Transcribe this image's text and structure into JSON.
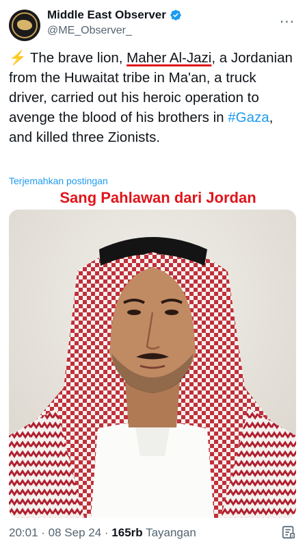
{
  "account": {
    "name": "Middle East Observer",
    "handle": "@ME_Observer_",
    "more_label": "···"
  },
  "tweet": {
    "bolt": "⚡",
    "part1": " The brave lion, ",
    "name_link": "Maher Al-Jazi",
    "part2": ", a Jordanian from the Huwaitat tribe in Ma'an, a truck driver, carried out his heroic operation to avenge the blood of his brothers in ",
    "hashtag": "#Gaza",
    "part3": ", and killed three Zionists."
  },
  "translate_label": "Terjemahkan postingan",
  "overlay_caption": "Sang Pahlawan dari Jordan",
  "footer": {
    "time": "20:01",
    "sep1": " · ",
    "date": "08 Sep 24",
    "sep2": " · ",
    "views_count": "165rb",
    "views_label": " Tayangan"
  },
  "colors": {
    "accent_blue": "#1d9bf0",
    "caption_red": "#e0141a",
    "underline_red": "#e0141a",
    "verified_blue": "#1d9bf0"
  },
  "icons": [
    "verified-badge-icon",
    "more-icon",
    "bolt-icon",
    "view-stats-icon"
  ]
}
